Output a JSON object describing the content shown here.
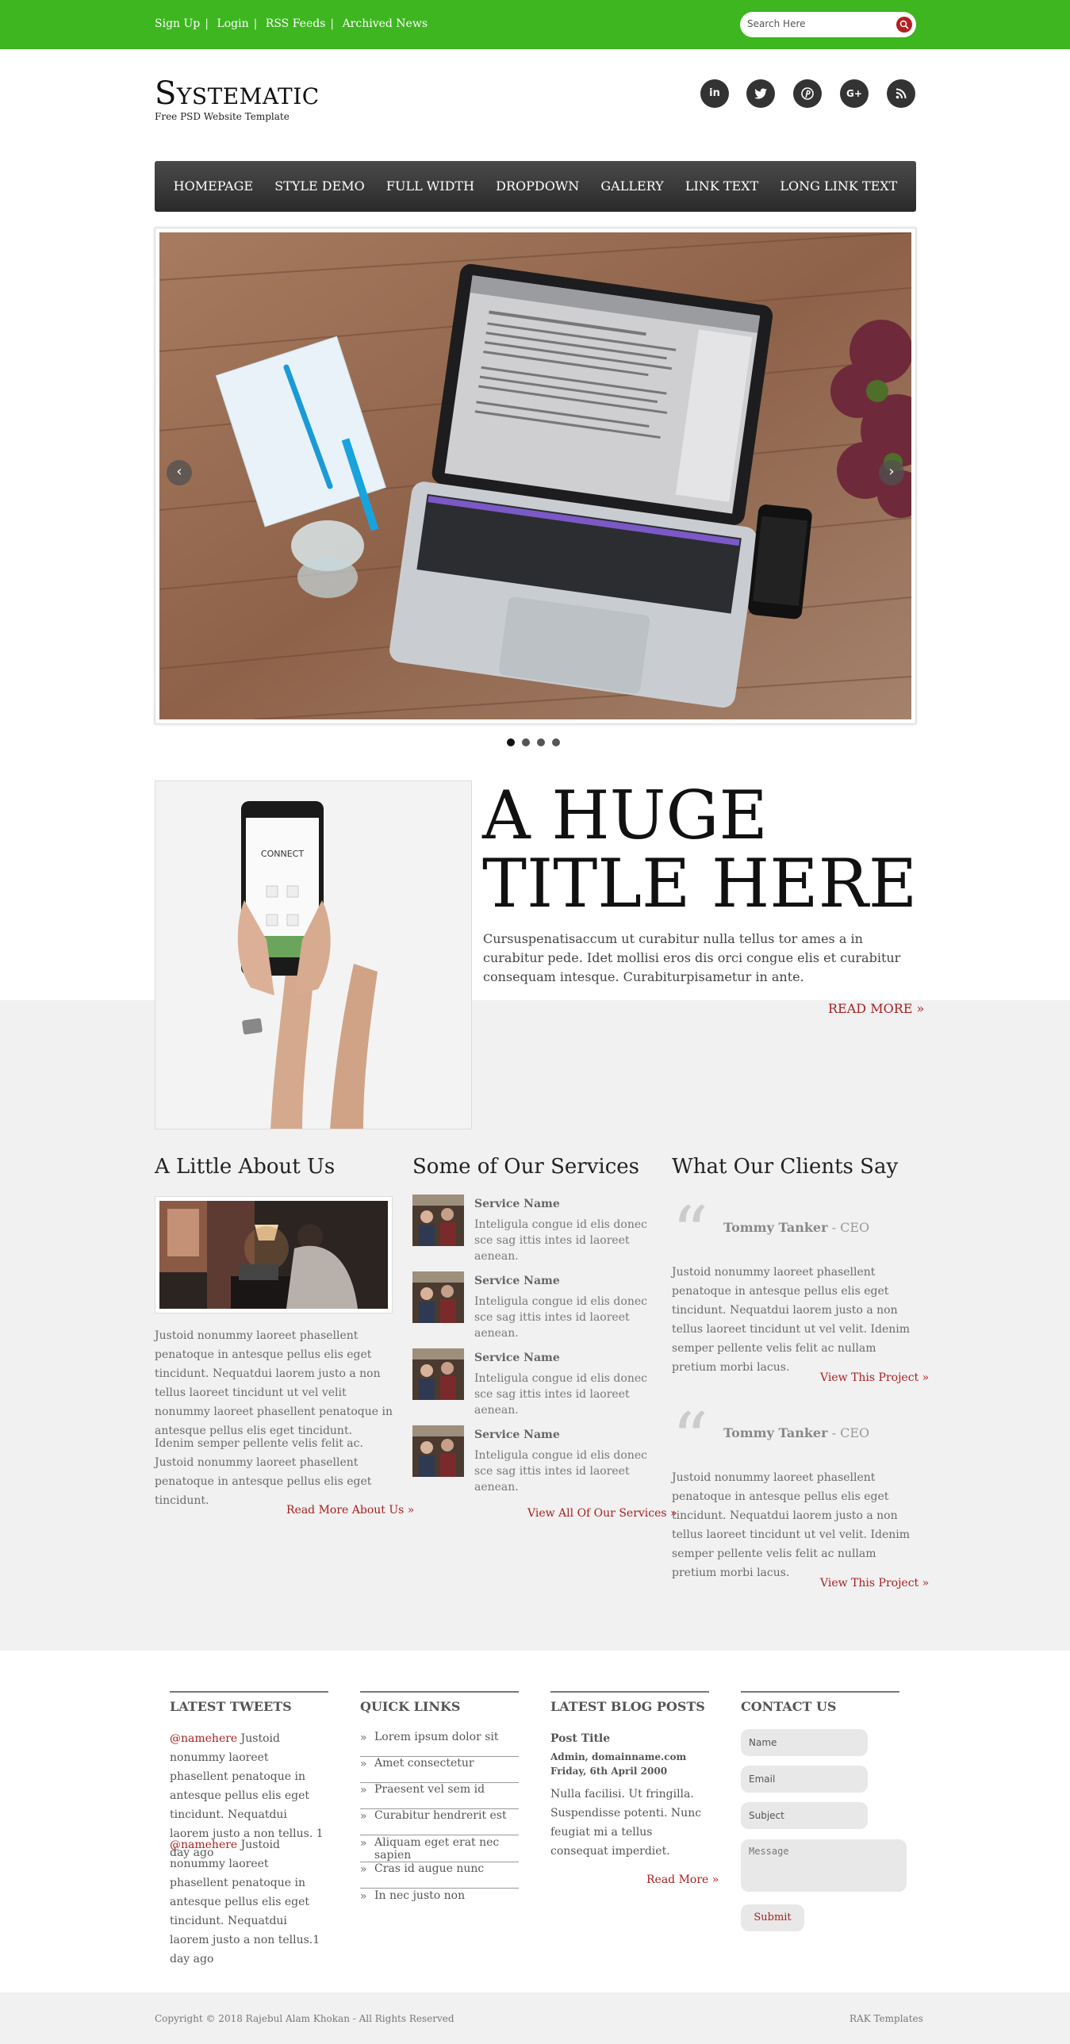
{
  "topbar": {
    "links": [
      "Sign Up",
      "Login",
      "RSS Feeds",
      "Archived News"
    ],
    "search_placeholder": "Search Here"
  },
  "header": {
    "logo": "Systematic",
    "tagline": "Free PSD Website Template",
    "social": [
      "linkedin-icon",
      "twitter-icon",
      "pinterest-icon",
      "googleplus-icon",
      "rss-icon"
    ]
  },
  "nav": [
    "Homepage",
    "Style Demo",
    "Full Width",
    "Dropdown",
    "Gallery",
    "Link Text",
    "Long Link Text"
  ],
  "slider": {
    "arrow_left": "‹",
    "arrow_right": "›",
    "dot_count": 4,
    "active_dot": 0
  },
  "hero": {
    "title_line1": "A HUGE",
    "title_line2": "TITLE HERE",
    "text": "Cursuspenatisaccum ut curabitur nulla tellus tor ames a in curabitur pede. Idet mollisi eros dis orci congue elis et curabitur consequam intesque. Curabiturpisametur in ante.",
    "read_more": "READ MORE »",
    "phone_label": "CONNECT"
  },
  "about": {
    "heading": "A Little About Us",
    "p1": "Justoid nonummy laoreet phasellent penatoque in antesque pellus elis eget tincidunt. Nequatdui laorem justo a non tellus laoreet tincidunt ut vel velit nonummy laoreet phasellent penatoque in antesque pellus elis eget tincidunt.",
    "p2": "Idenim semper pellente velis felit ac. Justoid nonummy laoreet phasellent penatoque in antesque pellus elis eget tincidunt.",
    "link": "Read More About Us »"
  },
  "services": {
    "heading": "Some of Our Services",
    "items": [
      {
        "name": "Service Name",
        "text": "Inteligula congue id elis donec sce sag ittis intes id laoreet aenean."
      },
      {
        "name": "Service Name",
        "text": "Inteligula congue id elis donec sce sag ittis intes id laoreet aenean."
      },
      {
        "name": "Service Name",
        "text": "Inteligula congue id elis donec sce sag ittis intes id laoreet aenean."
      },
      {
        "name": "Service Name",
        "text": "Inteligula congue id elis donec sce sag ittis intes id laoreet aenean."
      }
    ],
    "link": "View All Of Our Services »"
  },
  "clients": {
    "heading": "What Our Clients Say",
    "items": [
      {
        "name": "Tommy Tanker",
        "role": "- CEO",
        "text": "Justoid nonummy laoreet phasellent penatoque in antesque pellus elis eget tincidunt. Nequatdui laorem justo a non tellus laoreet tincidunt ut vel velit. Idenim semper pellente velis felit ac nullam pretium morbi lacus.",
        "link": "View This Project »"
      },
      {
        "name": "Tommy Tanker",
        "role": "- CEO",
        "text": "Justoid nonummy laoreet phasellent penatoque in antesque pellus elis eget tincidunt. Nequatdui laorem justo a non tellus laoreet tincidunt ut vel velit. Idenim semper pellente velis felit ac nullam pretium morbi lacus.",
        "link": "View This Project »"
      }
    ]
  },
  "footer": {
    "tweets": {
      "heading": "Latest Tweets",
      "items": [
        {
          "handle": "@namehere",
          "text": " Justoid nonummy laoreet phasellent penatoque in antesque pellus elis eget tincidunt. Nequatdui laorem justo a non tellus. 1 day ago"
        },
        {
          "handle": "@namehere",
          "text": " Justoid nonummy laoreet phasellent penatoque in antesque pellus elis eget tincidunt. Nequatdui laorem justo a non tellus.1 day ago"
        }
      ]
    },
    "quick_links": {
      "heading": "Quick Links",
      "items": [
        "Lorem ipsum dolor sit",
        "Amet consectetur",
        "Praesent vel sem id",
        "Curabitur hendrerit est",
        "Aliquam eget erat nec sapien",
        "Cras id augue nunc",
        "In nec justo non"
      ]
    },
    "blog": {
      "heading": "Latest Blog Posts",
      "post_title": "Post Title",
      "meta1": "Admin, domainname.com",
      "meta2": "Friday, 6th April 2000",
      "text": "Nulla facilisi. Ut fringilla. Suspendisse potenti. Nunc feugiat mi a tellus consequat imperdiet.",
      "link": "Read More »"
    },
    "contact": {
      "heading": "Contact Us",
      "name_ph": "Name",
      "email_ph": "Email",
      "subject_ph": "Subject",
      "message_ph": "Message",
      "submit": "Submit"
    }
  },
  "copyright": {
    "left": "Copyright © 2018 Rajebul Alam Khokan - All Rights Reserved",
    "right": "RAK Templates"
  },
  "colors": {
    "topbar": "#3db61f",
    "accent": "#a82020",
    "nav": "#333333"
  }
}
